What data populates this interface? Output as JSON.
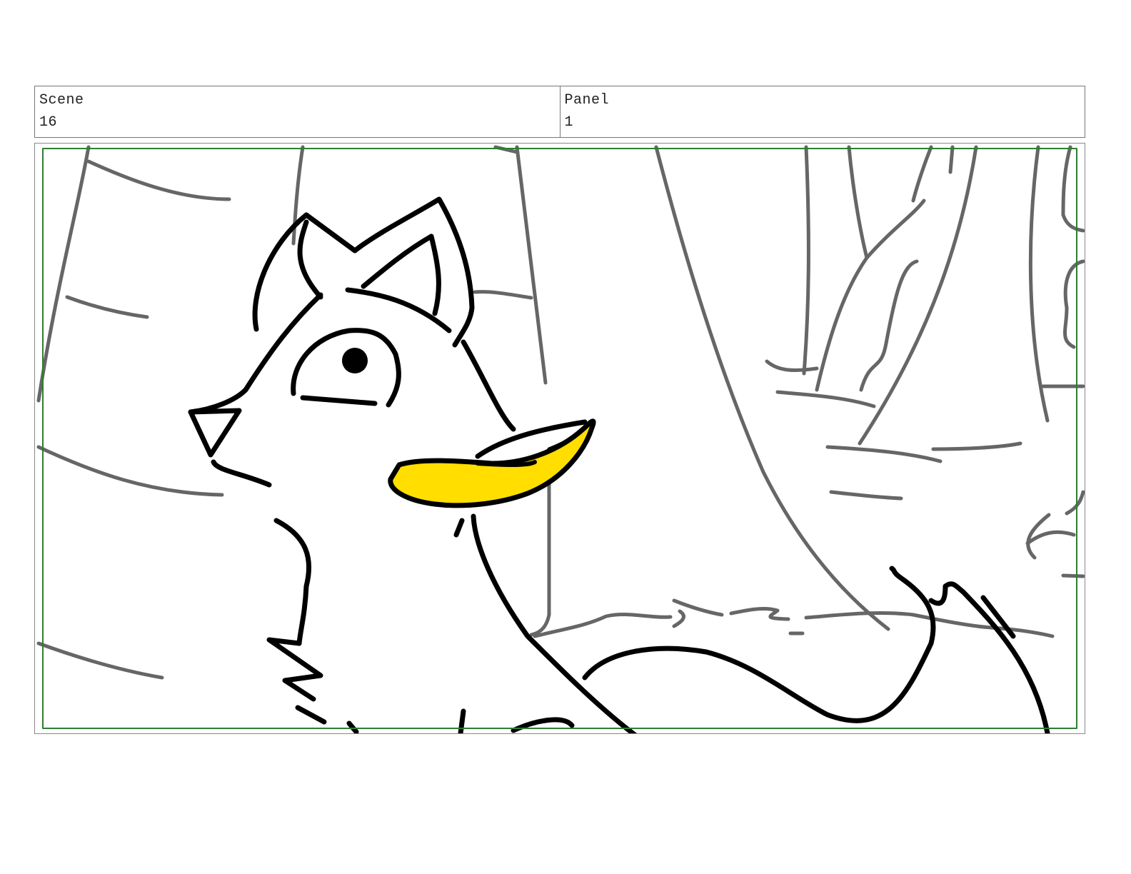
{
  "header": {
    "scene_label": "Scene",
    "scene_value": "16",
    "panel_label": "Panel",
    "panel_value": "1"
  },
  "drawing": {
    "subject": "fox-with-banana-sketch",
    "colors": {
      "safe_area_border": "#2e7d32",
      "banana_fill": "#ffde00",
      "line_black": "#000000",
      "line_gray": "#666666"
    }
  }
}
